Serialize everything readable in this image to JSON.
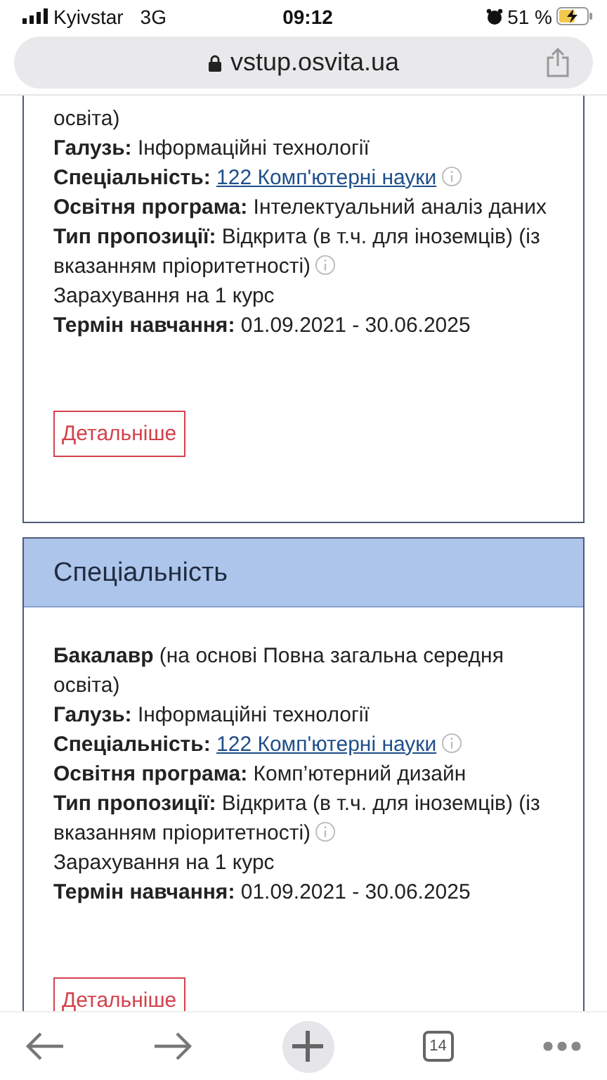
{
  "status_bar": {
    "carrier": "Kyivstar",
    "network": "3G",
    "time": "09:12",
    "battery": "51 %"
  },
  "address_bar": {
    "url": "vstup.osvita.ua"
  },
  "cards": [
    {
      "items": [
        {
          "kind": "plain",
          "text": "освіта)"
        },
        {
          "kind": "field",
          "label": "Галузь:",
          "value": "Інформаційні технології",
          "info": false
        },
        {
          "kind": "link",
          "label": "Спеціальність:",
          "value": "122 Комп'ютерні науки",
          "info": true
        },
        {
          "kind": "field",
          "label": "Освітня програма:",
          "value": "Інтелектуальний аналіз даних",
          "info": false
        },
        {
          "kind": "field",
          "label": "Тип пропозиції:",
          "value": "Відкрита (в т.ч. для іноземців) (із вказанням пріоритетності)",
          "info": true
        },
        {
          "kind": "plain",
          "text": "Зарахування на 1 курс"
        },
        {
          "kind": "field",
          "label": "Термін навчання:",
          "value": "01.09.2021 - 30.06.2025",
          "info": false
        }
      ],
      "button": "Детальніше"
    },
    {
      "title": "Спеціальність",
      "items": [
        {
          "kind": "degree",
          "degree": "Бакалавр",
          "basis": "(на основі Повна загальна середня освіта)"
        },
        {
          "kind": "field",
          "label": "Галузь:",
          "value": "Інформаційні технології",
          "info": false
        },
        {
          "kind": "link",
          "label": "Спеціальність:",
          "value": "122 Комп'ютерні науки",
          "info": true
        },
        {
          "kind": "field",
          "label": "Освітня програма:",
          "value": "Комп’ютерний дизайн",
          "info": false
        },
        {
          "kind": "field",
          "label": "Тип пропозиції:",
          "value": "Відкрита (в т.ч. для іноземців) (із вказанням пріоритетності)",
          "info": true
        },
        {
          "kind": "plain",
          "text": "Зарахування на 1 курс"
        },
        {
          "kind": "field",
          "label": "Термін навчання:",
          "value": "01.09.2021 - 30.06.2025",
          "info": false
        }
      ],
      "button": "Детальніше"
    }
  ],
  "toolbar": {
    "tab_count": "14"
  }
}
